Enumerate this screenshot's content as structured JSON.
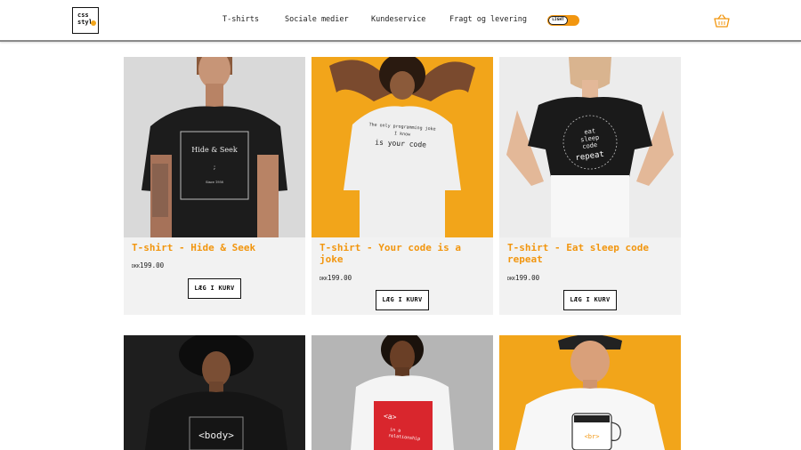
{
  "header": {
    "logo_line1": "css",
    "logo_line2": "styl",
    "nav": [
      "T-shirts",
      "Sociale medier",
      "Kundeservice",
      "Fragt og levering"
    ],
    "theme_toggle_label": "LIGHT"
  },
  "products": [
    {
      "title": "T-shirt - Hide & Seek",
      "currency": "DKK",
      "price": "199.00",
      "button": "LÆG I KURV",
      "print_line1": "Hide & Seek",
      "print_line2": ";",
      "print_line3": "Since 1958"
    },
    {
      "title": "T-shirt - Your code is a joke",
      "currency": "DKK",
      "price": "199.00",
      "button": "LÆG I KURV",
      "print_line1": "The only programming joke",
      "print_line2": "I know",
      "print_line3": "is your code"
    },
    {
      "title": "T-shirt - Eat sleep code repeat",
      "currency": "DKK",
      "price": "199.00",
      "button": "LÆG I KURV",
      "print_line1": "eat",
      "print_line2": "sleep",
      "print_line3": "code",
      "print_line4": "repeat"
    },
    {
      "print_line1": "<body>"
    },
    {
      "print_line1": "<a>",
      "print_line2": "in a",
      "print_line3": "relationship"
    },
    {
      "print_line1": "<br>"
    }
  ],
  "colors": {
    "accent": "#f2960f",
    "card_bg": "#f2f2f2",
    "photo_orange": "#f2a51a"
  }
}
